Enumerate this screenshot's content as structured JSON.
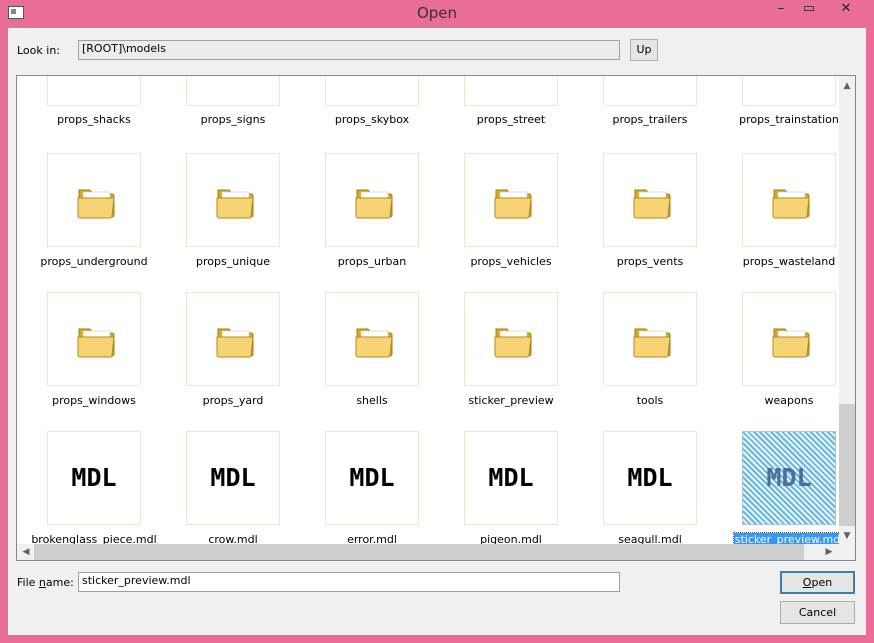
{
  "window": {
    "title": "Open",
    "min_glyph": "–",
    "max_glyph": "▭",
    "close_glyph": "✕"
  },
  "lookin": {
    "label": "Look in:",
    "value": "[ROOT]\\models",
    "up_label": "Up"
  },
  "filename": {
    "label_pre": "File ",
    "label_underlined": "n",
    "label_post": "ame:",
    "value": "sticker_preview.mdl"
  },
  "buttons": {
    "open_underlined": "O",
    "open_rest": "pen",
    "cancel": "Cancel"
  },
  "items": [
    {
      "name": "props_shacks",
      "type": "folder"
    },
    {
      "name": "props_signs",
      "type": "folder"
    },
    {
      "name": "props_skybox",
      "type": "folder"
    },
    {
      "name": "props_street",
      "type": "folder"
    },
    {
      "name": "props_trailers",
      "type": "folder"
    },
    {
      "name": "props_trainstation",
      "type": "folder"
    },
    {
      "name": "props_underground",
      "type": "folder"
    },
    {
      "name": "props_unique",
      "type": "folder"
    },
    {
      "name": "props_urban",
      "type": "folder"
    },
    {
      "name": "props_vehicles",
      "type": "folder"
    },
    {
      "name": "props_vents",
      "type": "folder"
    },
    {
      "name": "props_wasteland",
      "type": "folder"
    },
    {
      "name": "props_windows",
      "type": "folder"
    },
    {
      "name": "props_yard",
      "type": "folder"
    },
    {
      "name": "shells",
      "type": "folder"
    },
    {
      "name": "sticker_preview",
      "type": "folder"
    },
    {
      "name": "tools",
      "type": "folder"
    },
    {
      "name": "weapons",
      "type": "folder"
    },
    {
      "name": "brokenglass_piece.mdl",
      "type": "mdl",
      "thumb_text": "MDL"
    },
    {
      "name": "crow.mdl",
      "type": "mdl",
      "thumb_text": "MDL"
    },
    {
      "name": "error.mdl",
      "type": "mdl",
      "thumb_text": "MDL"
    },
    {
      "name": "pigeon.mdl",
      "type": "mdl",
      "thumb_text": "MDL"
    },
    {
      "name": "seagull.mdl",
      "type": "mdl",
      "thumb_text": "MDL"
    },
    {
      "name": "sticker_preview.mdl",
      "type": "mdl",
      "thumb_text": "MDL",
      "selected": true
    }
  ],
  "scroll": {
    "up_glyph": "▲",
    "down_glyph": "▼",
    "left_glyph": "◀",
    "right_glyph": "▶"
  },
  "colors": {
    "frame": "#e86d98",
    "selection": "#3399ff"
  }
}
